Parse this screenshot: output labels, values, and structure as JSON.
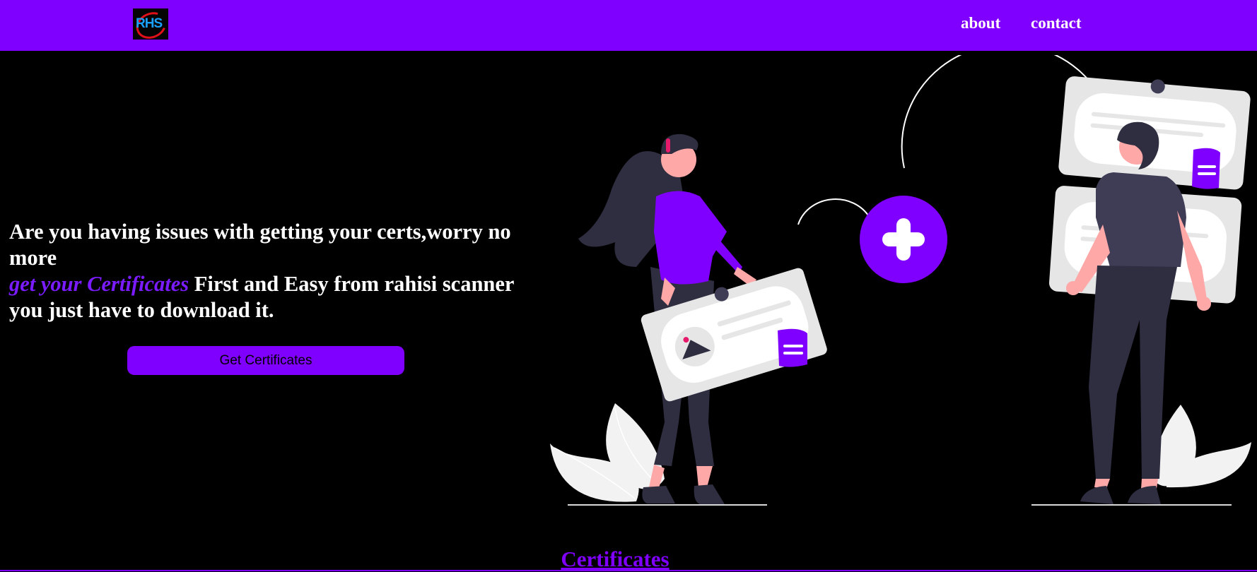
{
  "navbar": {
    "logo_text": "RHS",
    "links": [
      "about",
      "contact"
    ]
  },
  "hero": {
    "heading_line1": "Are you having issues with getting your certs,worry no more",
    "heading_accent": "get your Certificates",
    "heading_line2": " First and Easy from rahisi scanner you just have to download it.",
    "cta_label": "Get Certificates"
  },
  "section": {
    "title": "Certificates"
  },
  "colors": {
    "brand": "#8000ff",
    "background": "#000000",
    "text": "#ffffff",
    "skin": "#ffa8a8",
    "dark_figure": "#2f2e41",
    "card": "#e6e6e6"
  },
  "icons": [
    "plus-icon",
    "certificate-card-icon",
    "document-icon"
  ]
}
